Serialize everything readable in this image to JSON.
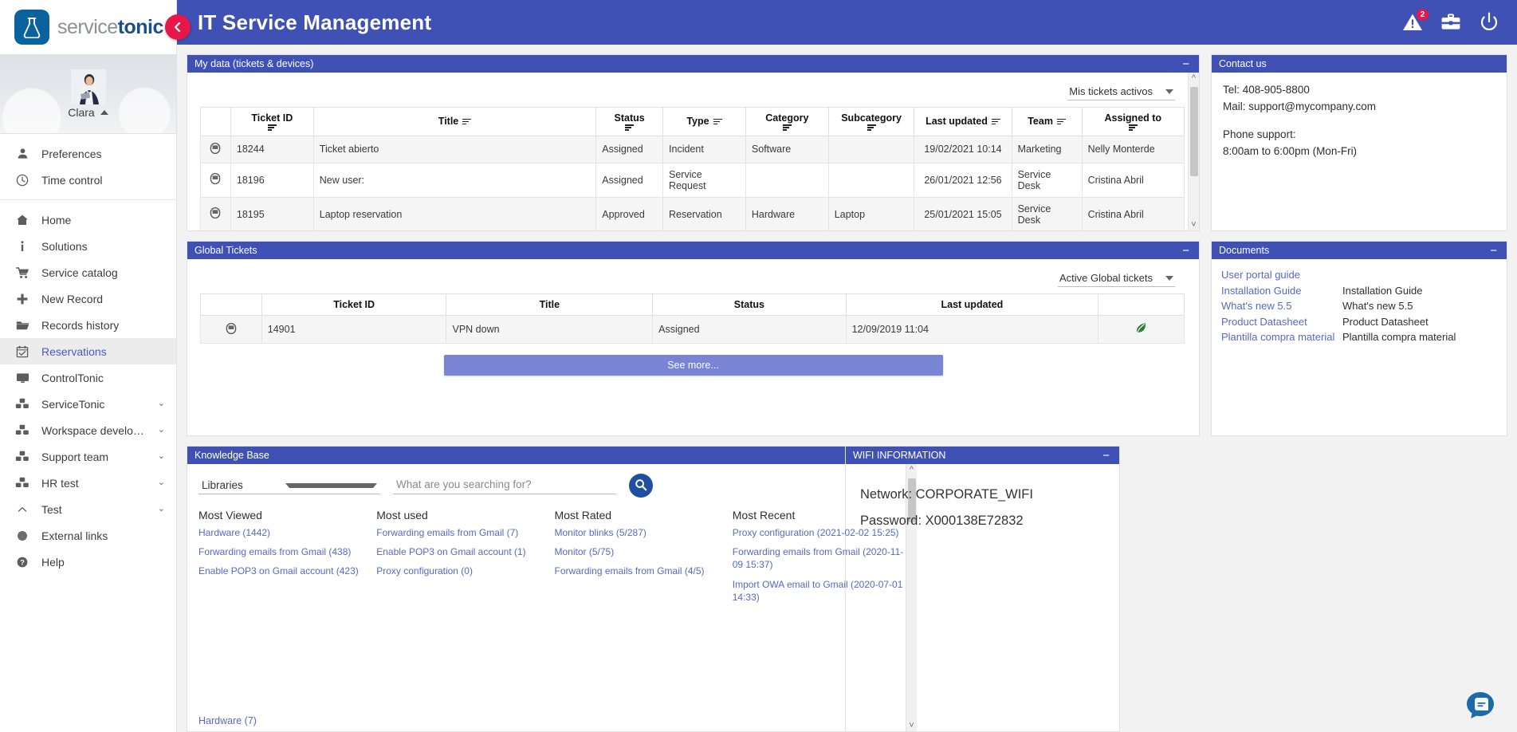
{
  "brand": {
    "part1": "service",
    "part2": "tonic",
    "logo_icon": "flask-icon"
  },
  "collapse": {
    "icon": "chevron-left-icon"
  },
  "user": {
    "name": "Clara",
    "caret_icon": "caret-up-icon"
  },
  "sidebar": {
    "group1": [
      {
        "label": "Preferences",
        "icon": "person-icon"
      },
      {
        "label": "Time control",
        "icon": "clock-icon"
      }
    ],
    "group2": [
      {
        "label": "Home",
        "icon": "home-icon",
        "active": false,
        "chevron": ""
      },
      {
        "label": "Solutions",
        "icon": "info-icon",
        "active": false,
        "chevron": ""
      },
      {
        "label": "Service catalog",
        "icon": "cart-icon",
        "active": false,
        "chevron": ""
      },
      {
        "label": "New Record",
        "icon": "plus-icon",
        "active": false,
        "chevron": ""
      },
      {
        "label": "Records history",
        "icon": "folder-icon",
        "active": false,
        "chevron": ""
      },
      {
        "label": "Reservations",
        "icon": "calendar-check-icon",
        "active": true,
        "chevron": ""
      },
      {
        "label": "ControlTonic",
        "icon": "monitor-icon",
        "active": false,
        "chevron": ""
      },
      {
        "label": "ServiceTonic",
        "icon": "blocks-icon",
        "active": false,
        "chevron": "⌄"
      },
      {
        "label": "Workspace developers",
        "icon": "blocks-icon",
        "active": false,
        "chevron": "⌄"
      },
      {
        "label": "Support team",
        "icon": "blocks-icon",
        "active": false,
        "chevron": "⌄"
      },
      {
        "label": "HR test",
        "icon": "blocks-icon",
        "active": false,
        "chevron": "⌄"
      },
      {
        "label": "Test",
        "icon": "caret-up-icon",
        "active": false,
        "chevron": "⌄"
      },
      {
        "label": "External links",
        "icon": "circle-icon",
        "active": false,
        "chevron": ""
      },
      {
        "label": "Help",
        "icon": "question-circle-icon",
        "active": false,
        "chevron": ""
      }
    ]
  },
  "topbar": {
    "title": "IT Service Management",
    "alerts_icon": "warning-triangle-icon",
    "alerts_badge": "2",
    "briefcase_icon": "briefcase-icon",
    "power_icon": "power-icon"
  },
  "mydata": {
    "title": "My data (tickets & devices)",
    "minimize_label": "−",
    "filter_value": "Mis tickets activos",
    "columns": [
      "",
      "Ticket ID",
      "Title",
      "Status",
      "Type",
      "Category",
      "Subcategory",
      "Last updated",
      "Team",
      "Assigned to"
    ],
    "rows": [
      {
        "icon": "ticket-icon",
        "id": "18244",
        "title": "Ticket abierto",
        "status": "Assigned",
        "type": "Incident",
        "category": "Software",
        "subcategory": "",
        "updated": "19/02/2021 10:14",
        "team": "Marketing",
        "assigned": "Nelly Monterde"
      },
      {
        "icon": "ticket-icon",
        "id": "18196",
        "title": "New user:",
        "status": "Assigned",
        "type": "Service Request",
        "category": "",
        "subcategory": "",
        "updated": "26/01/2021 12:56",
        "team": "Service Desk",
        "assigned": "Cristina Abril"
      },
      {
        "icon": "ticket-icon",
        "id": "18195",
        "title": "Laptop reservation",
        "status": "Approved",
        "type": "Reservation",
        "category": "Hardware",
        "subcategory": "Laptop",
        "updated": "25/01/2021 15:05",
        "team": "Service Desk",
        "assigned": "Cristina Abril"
      }
    ]
  },
  "contact": {
    "title": "Contact us",
    "tel": "Tel: 408-905-8800",
    "mail": "Mail: support@mycompany.com",
    "support_label": "Phone support:",
    "support_hours": "8:00am to 6:00pm (Mon-Fri)"
  },
  "global": {
    "title": "Global Tickets",
    "minimize_label": "−",
    "filter_value": "Active Global tickets",
    "columns": [
      "",
      "Ticket ID",
      "Title",
      "Status",
      "Last updated",
      ""
    ],
    "rows": [
      {
        "icon": "ticket-icon",
        "id": "14901",
        "title": "VPN down",
        "status": "Assigned",
        "updated": "12/09/2019 11:04",
        "attachment_icon": "attachment-leaf-icon"
      }
    ],
    "see_more": "See more..."
  },
  "documents": {
    "title": "Documents",
    "minimize_label": "−",
    "rows": [
      {
        "link": "User portal guide",
        "desc": ""
      },
      {
        "link": "Installation Guide",
        "desc": "Installation Guide"
      },
      {
        "link": "What's new 5.5",
        "desc": "What's new 5.5"
      },
      {
        "link": "Product Datasheet",
        "desc": "Product Datasheet"
      },
      {
        "link": "Plantilla compra material",
        "desc": "Plantilla compra material"
      }
    ]
  },
  "knowledge": {
    "title": "Knowledge Base",
    "minimize_label": "−",
    "library_value": "Libraries",
    "search_placeholder": "What are you searching for?",
    "search_value": "",
    "search_icon": "search-icon",
    "columns": [
      {
        "heading": "Most Viewed",
        "items": [
          "Hardware (1442)",
          "Forwarding emails from Gmail (438)",
          "Enable POP3 on Gmail account (423)"
        ]
      },
      {
        "heading": "Most used",
        "items": [
          "Forwarding emails from Gmail (7)",
          "Enable POP3 on Gmail account (1)",
          "Proxy configuration (0)"
        ]
      },
      {
        "heading": "Most Rated",
        "items": [
          "Monitor blinks (5/287)",
          "Monitor (5/75)",
          "Forwarding emails from Gmail (4/5)"
        ]
      },
      {
        "heading": "Most Recent",
        "items": [
          "Proxy configuration (2021-02-02 15:25)",
          "Forwarding emails from Gmail (2020-11-09 15:37)",
          "Import OWA email to Gmail (2020-07-01 14:33)"
        ]
      }
    ],
    "footer_link": "Hardware (7)"
  },
  "wifi": {
    "title": "WIFI INFORMATION",
    "minimize_label": "−",
    "network": "Network: CORPORATE_WIFI",
    "password": "Password: X000138E72832"
  },
  "chat": {
    "icon": "chat-bubble-icon"
  },
  "colors": {
    "primary": "#3f51b5",
    "accent_pink": "#e8174a",
    "link": "#5569c9",
    "button": "#7884d4",
    "logo_blue": "#0a639f"
  }
}
